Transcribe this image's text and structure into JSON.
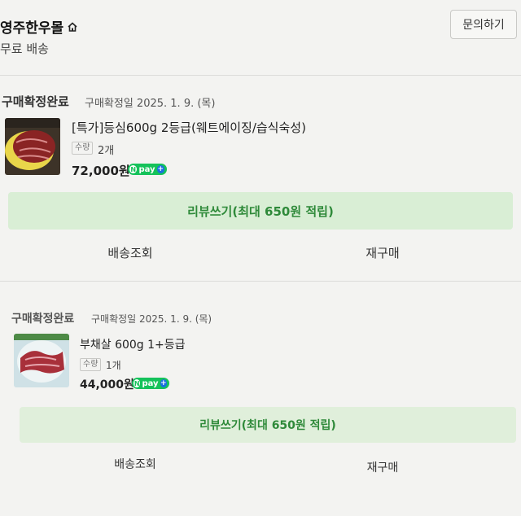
{
  "store": {
    "name": "영주한우몰",
    "shipping": "무료 배송",
    "inquiry_label": "문의하기"
  },
  "orders": [
    {
      "status": "구매확정완료",
      "confirm_date": "구매확정일 2025. 1. 9. (목)",
      "product_name": "[특가]등심600g 2등급(웨트에이징/습식숙성)",
      "qty_label": "수량",
      "qty_value": "2개",
      "price": "72,000원",
      "npay": "pay",
      "review_label": "리뷰쓰기(최대 650원 적립)",
      "track_label": "배송조회",
      "reorder_label": "재구매"
    },
    {
      "status": "구매확정완료",
      "confirm_date": "구매확정일 2025. 1. 9. (목)",
      "product_name": "부채살 600g 1+등급",
      "qty_label": "수량",
      "qty_value": "1개",
      "price": "44,000원",
      "npay": "pay",
      "review_label": "리뷰쓰기(최대 650원 적립)",
      "track_label": "배송조회",
      "reorder_label": "재구매"
    }
  ],
  "colors": {
    "review_bg": "#d9eed5",
    "review_text": "#2f8a3a",
    "npay_green": "#14c25a"
  }
}
